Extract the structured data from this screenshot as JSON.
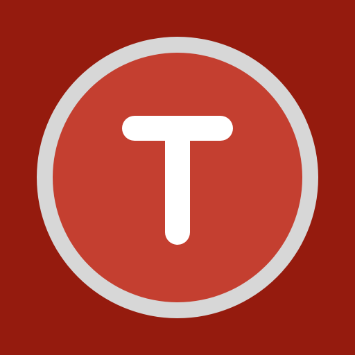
{
  "icon": {
    "name": "letter-t-app-icon",
    "glyph": "T"
  },
  "colors": {
    "background": "#951b0e",
    "ring": "#d7d7d7",
    "disc": "#c43f30",
    "glyph": "#ffffff"
  }
}
